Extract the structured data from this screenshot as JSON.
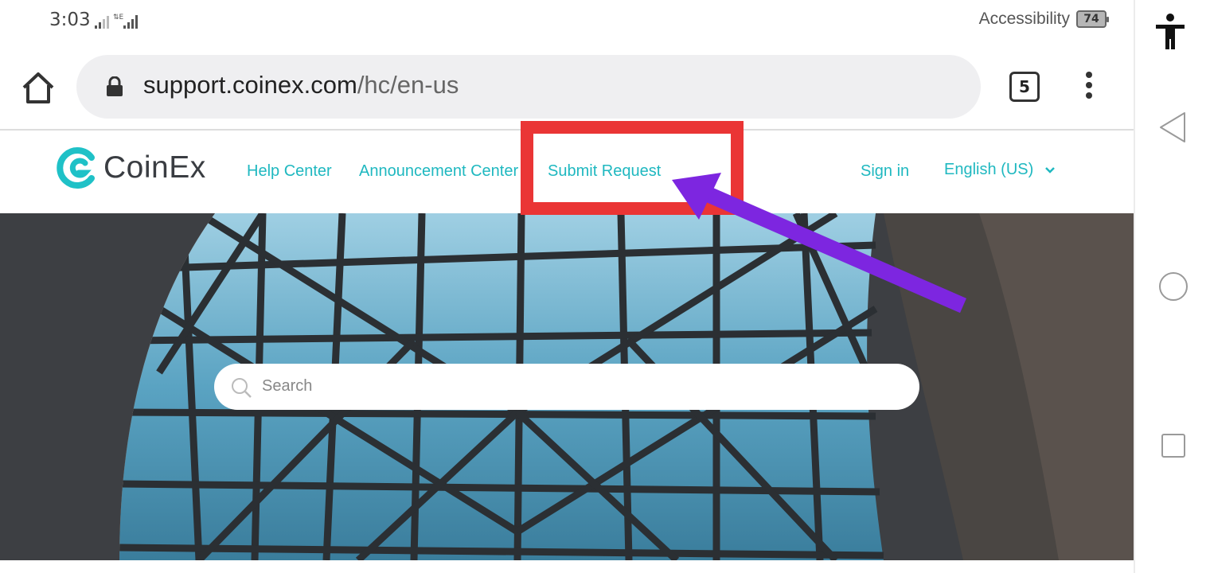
{
  "status_bar": {
    "time": "3:03",
    "accessibility_label": "Accessibility",
    "battery_level": "74"
  },
  "browser": {
    "url_domain": "support.coinex.com",
    "url_path": "/hc/en-us",
    "tab_count": "5"
  },
  "site": {
    "logo_text": "CoinEx",
    "nav": {
      "help_center": "Help Center",
      "announcement_center": "Announcement Center",
      "submit_request": "Submit Request",
      "sign_in": "Sign in",
      "language": "English (US)"
    },
    "search": {
      "placeholder": "Search"
    }
  },
  "colors": {
    "brand_teal": "#1fb8c0",
    "highlight_red": "#ea3535",
    "arrow_purple": "#7d26e0"
  },
  "icons": [
    "home-icon",
    "lock-icon",
    "tabs-icon",
    "more-vert-icon",
    "search-icon",
    "chevron-down-icon",
    "accessibility-icon",
    "back-icon",
    "home-circle-icon",
    "recents-icon"
  ]
}
